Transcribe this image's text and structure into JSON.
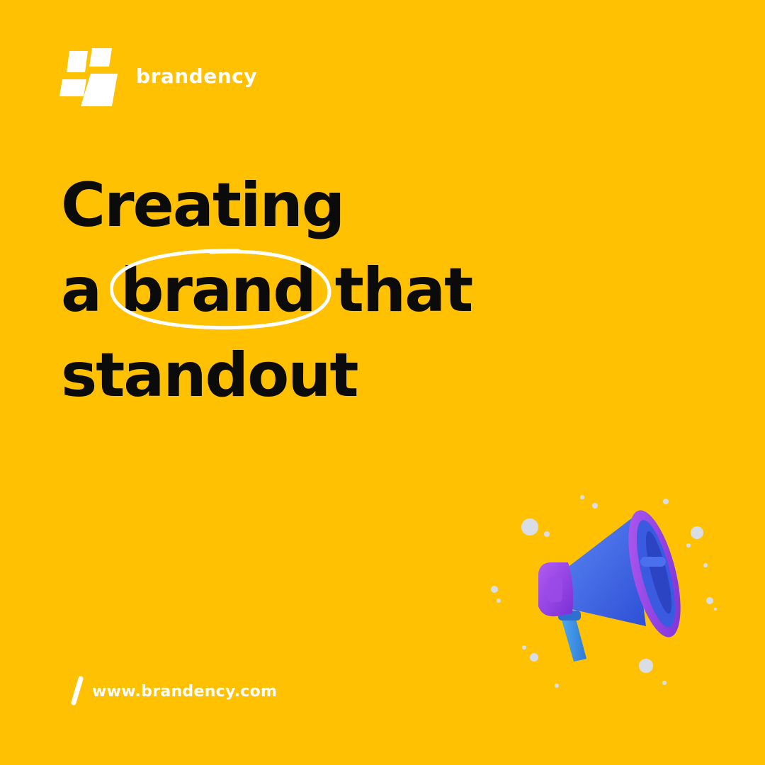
{
  "brand": {
    "name": "brandency",
    "logo_icon": "window-panes-logo-icon"
  },
  "headline": {
    "line1": "Creating",
    "line2_prefix": "a",
    "line2_highlight": "brand",
    "line2_suffix": "that",
    "line3": "standout"
  },
  "illustration": {
    "icon": "megaphone-icon"
  },
  "footer": {
    "url": "www.brandency.com",
    "icon": "slash-icon"
  },
  "colors": {
    "background": "#FFC101",
    "text": "#0B0B0B",
    "accent": "#FFFFFF",
    "megaphone_body": "#3D63E8",
    "megaphone_rim": "#8B3FE0"
  }
}
